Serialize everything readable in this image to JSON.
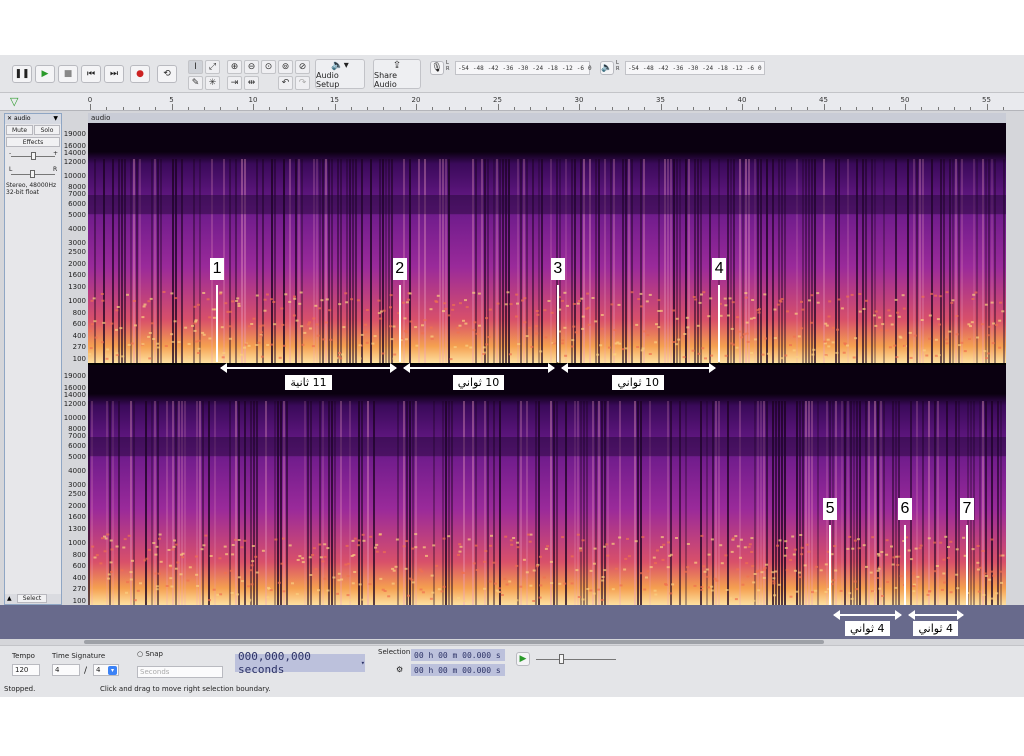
{
  "toolbar": {
    "audio_setup_label": "Audio Setup",
    "share_audio_label": "Share Audio",
    "record_meter_ticks": [
      "-54",
      "-48",
      "-42",
      "-36",
      "-30",
      "-24",
      "-18",
      "-12",
      "-6",
      "0"
    ],
    "playback_meter_ticks": [
      "-54",
      "-48",
      "-42",
      "-36",
      "-30",
      "-24",
      "-18",
      "-12",
      "-6",
      "0"
    ],
    "meter_channel_labels": [
      "L",
      "R"
    ]
  },
  "ruler": {
    "ticks": [
      "0",
      "5",
      "10",
      "15",
      "20",
      "25",
      "30",
      "35",
      "40",
      "45",
      "50",
      "55"
    ]
  },
  "track": {
    "name": "audio",
    "mute_label": "Mute",
    "solo_label": "Solo",
    "effects_label": "Effects",
    "info_line1": "Stereo, 48000Hz",
    "info_line2": "32-bit float",
    "select_label": "Select",
    "pan_labels": [
      "L",
      "R"
    ],
    "gain_labels": [
      "-",
      "+"
    ]
  },
  "frequency_axis": [
    "19000",
    "16000",
    "14000",
    "12000",
    "10000",
    "8000",
    "7000",
    "6000",
    "5000",
    "4000",
    "3000",
    "2500",
    "2000",
    "1600",
    "1300",
    "1000",
    "800",
    "600",
    "400",
    "270",
    "100"
  ],
  "annotations": {
    "markers": [
      {
        "label": "1",
        "time": 7.8,
        "channel": "top"
      },
      {
        "label": "2",
        "time": 19.0,
        "channel": "top"
      },
      {
        "label": "3",
        "time": 28.7,
        "channel": "top"
      },
      {
        "label": "4",
        "time": 38.6,
        "channel": "top"
      },
      {
        "label": "5",
        "time": 45.4,
        "channel": "bottom"
      },
      {
        "label": "6",
        "time": 50.0,
        "channel": "bottom"
      },
      {
        "label": "7",
        "time": 53.8,
        "channel": "bottom"
      }
    ],
    "spans": [
      {
        "label": "11 ثانية"
      },
      {
        "label": "10 ثواني"
      },
      {
        "label": "10 ثواني"
      },
      {
        "label": "4 ثواني"
      },
      {
        "label": "4 ثواني"
      }
    ]
  },
  "bottom_bar": {
    "tempo_label": "Tempo",
    "tempo_value": "120",
    "time_signature_label": "Time Signature",
    "ts_numerator": "4",
    "ts_slash": "/",
    "ts_denominator": "4",
    "snap_label": "Snap",
    "snap_unit": "Seconds",
    "time_display": "000,000,000 seconds",
    "selection_label": "Selection",
    "selection_start": "00 h 00 m 00.000 s",
    "selection_end": "00 h 00 m 00.000 s"
  },
  "status": {
    "state": "Stopped.",
    "hint": "Click and drag to move right selection boundary."
  },
  "colors": {
    "accent_green": "#2a9a2a",
    "time_display_bg": "#bcc1dc",
    "spectrogram_low": "#f5c060",
    "spectrogram_mid": "#9a2a9a",
    "spectrogram_high": "#2a0a40"
  }
}
